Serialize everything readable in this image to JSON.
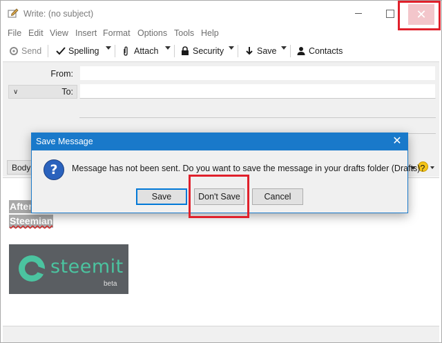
{
  "window": {
    "title": "Write: (no subject)",
    "close_glyph": "✕"
  },
  "menu": {
    "items": [
      {
        "label_u": "F",
        "label_rest": "ile"
      },
      {
        "label_u": "E",
        "label_rest": "dit"
      },
      {
        "label_u": "V",
        "label_rest": "iew"
      },
      {
        "label_u": "I",
        "label_rest": "nsert"
      },
      {
        "label_u": "F",
        "label_rest": "ormat",
        "underline_index": 1
      },
      {
        "label_u": "O",
        "label_rest": "ptions",
        "underline_index": 1
      },
      {
        "label_u": "T",
        "label_rest": "ools"
      },
      {
        "label_u": "H",
        "label_rest": "elp"
      }
    ],
    "labels": [
      "File",
      "Edit",
      "View",
      "Insert",
      "Format",
      "Options",
      "Tools",
      "Help"
    ]
  },
  "toolbar": {
    "send": "Send",
    "spelling": "Spelling",
    "attach": "Attach",
    "security": "Security",
    "save": "Save",
    "contacts": "Contacts"
  },
  "header": {
    "from_label": "From:",
    "to_label": "To:",
    "from_value": "",
    "to_value": ""
  },
  "format_bar": {
    "paragraph_style": "Body"
  },
  "compose": {
    "line1": "After",
    "line2": "Steemian",
    "image": {
      "brand": "steemit",
      "tag": "beta",
      "brand_color": "#4bc4a0"
    }
  },
  "dialog": {
    "title": "Save Message",
    "message": "Message has not been sent. Do you want to save the message in your drafts folder (Drafts)?",
    "buttons": {
      "save": "Save",
      "dont_save": "Don't Save",
      "cancel": "Cancel"
    },
    "close_glyph": "✕",
    "question_glyph": "?"
  },
  "colors": {
    "highlight": "#e0202b",
    "dialog_accent": "#1979ca"
  }
}
